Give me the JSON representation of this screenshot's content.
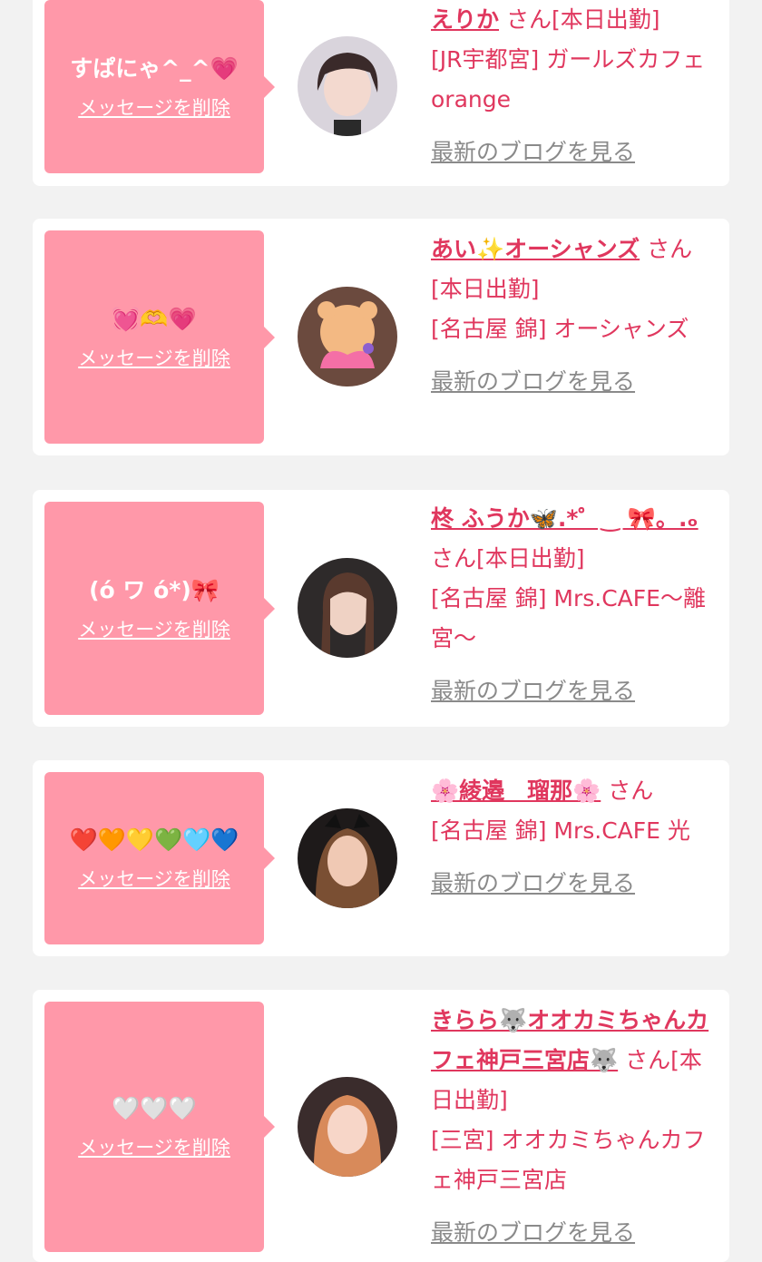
{
  "messages": [
    {
      "bubble_text": "すぱにゃ^_^💗",
      "delete_label": "メッセージを削除",
      "name": "えりか",
      "suffix": "さん[本日出勤]",
      "shop": "[JR宇都宮] ガールズカフェ orange",
      "blog_label": "最新のブログを見る"
    },
    {
      "bubble_text": "💓🫶💗",
      "delete_label": "メッセージを削除",
      "name": "あい✨オーシャンズ",
      "suffix": "さん[本日出勤]",
      "shop": "[名古屋 錦] オーシャンズ",
      "blog_label": "最新のブログを見る"
    },
    {
      "bubble_text": "(ό ワ ό*)🎀",
      "delete_label": "メッセージを削除",
      "name": "柊 ふうか🦋.*゜‿ 🎀。.ₒ",
      "suffix": "さん[本日出勤]",
      "shop": "[名古屋 錦] Mrs.CAFE〜離宮〜",
      "blog_label": "最新のブログを見る"
    },
    {
      "bubble_text": "❤️🧡💛💚🩵💙",
      "delete_label": "メッセージを削除",
      "name": "🌸綾邉　瑠那🌸",
      "suffix": "さん",
      "shop": "[名古屋 錦] Mrs.CAFE 光",
      "blog_label": "最新のブログを見る"
    },
    {
      "bubble_text": "🤍🤍🤍",
      "delete_label": "メッセージを削除",
      "name": "きらら🐺オオカミちゃんカフェ神戸三宮店🐺",
      "suffix": "さん[本日出勤]",
      "shop": "[三宮] オオカミちゃんカフェ神戸三宮店",
      "blog_label": "最新のブログを見る"
    }
  ],
  "colors": {
    "page_bg": "#f2f2f2",
    "bubble_bg": "#ff98a9",
    "name_color": "#e0375e",
    "link_gray": "#8a8a8a"
  }
}
